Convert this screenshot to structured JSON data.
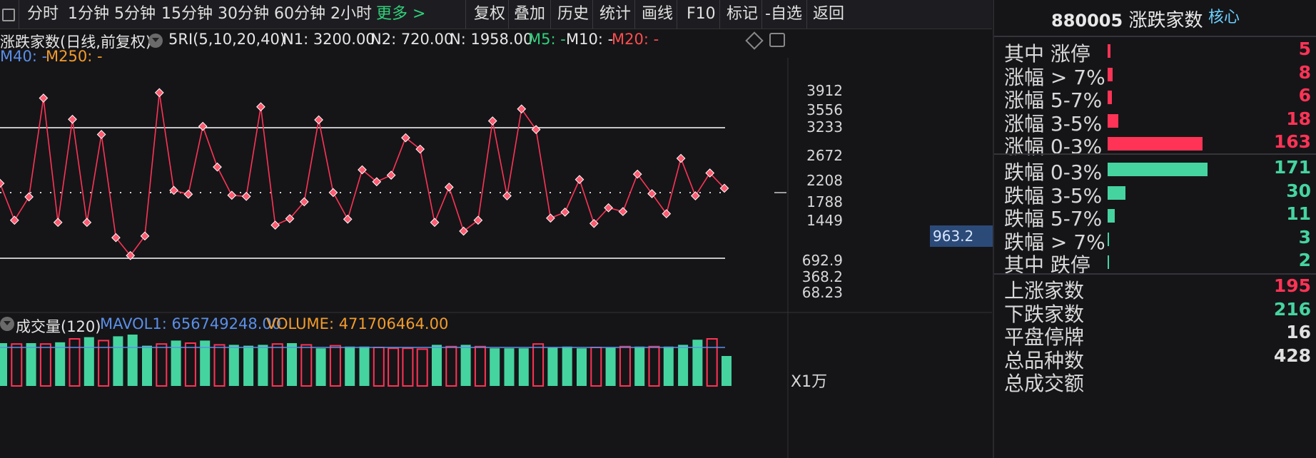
{
  "toolbar": {
    "items": [
      "分时",
      "1分钟",
      "5分钟",
      "15分钟",
      "30分钟",
      "60分钟",
      "2小时"
    ],
    "more": "更多 >",
    "right_items": [
      "复权",
      "叠加",
      "历史",
      "统计",
      "画线",
      "F10",
      "标记",
      "-自选",
      "返回"
    ]
  },
  "chart_header": {
    "title": "涨跌家数(日线,前复权)",
    "indicator": "5RI(5,10,20,40)",
    "n1": "N1: 3200.00",
    "n2": "N2: 720.00",
    "n": "N: 1958.00",
    "m5": "M5: -",
    "m10": "M10: -",
    "m20": "M20: -",
    "m40": "M40: -",
    "m250": "M250: -"
  },
  "price_tag": "963.2",
  "volume_header": {
    "title": "成交量(120)",
    "mavol": "MAVOL1: 656749248.00",
    "volume": "VOLUME: 471706464.00"
  },
  "volume_unit": "X1万",
  "colors": {
    "up": "#ff3355",
    "down": "#45d4a0",
    "line": "#ff3355",
    "grid_line": "#ffffff",
    "dotted": "#cccccc",
    "mavol": "#5b8fe8"
  },
  "right_panel": {
    "code": "880005",
    "name": "涨跌家数",
    "core": "核心",
    "up_rows": [
      {
        "label": "其中 涨停",
        "value": "5",
        "ratio": 0.03
      },
      {
        "label": "涨幅 > 7%",
        "value": "8",
        "ratio": 0.05
      },
      {
        "label": "涨幅 5-7%",
        "value": "6",
        "ratio": 0.04
      },
      {
        "label": "涨幅 3-5%",
        "value": "18",
        "ratio": 0.11
      },
      {
        "label": "涨幅 0-3%",
        "value": "163",
        "ratio": 0.95
      }
    ],
    "down_rows": [
      {
        "label": "跌幅 0-3%",
        "value": "171",
        "ratio": 1.0
      },
      {
        "label": "跌幅 3-5%",
        "value": "30",
        "ratio": 0.18
      },
      {
        "label": "跌幅 5-7%",
        "value": "11",
        "ratio": 0.07
      },
      {
        "label": "跌幅 > 7%",
        "value": "3",
        "ratio": 0.015
      },
      {
        "label": "其中 跌停",
        "value": "2",
        "ratio": 0.01
      }
    ],
    "summary": [
      {
        "label": "上涨家数",
        "value": "195",
        "color": "#ff3355"
      },
      {
        "label": "下跌家数",
        "value": "216",
        "color": "#45d4a0"
      },
      {
        "label": "平盘停牌",
        "value": "16",
        "color": "#e0e0e0"
      },
      {
        "label": "总品种数",
        "value": "428",
        "color": "#e0e0e0"
      },
      {
        "label": "总成交额",
        "value": "",
        "color": "#e0e0e0"
      }
    ]
  },
  "chart_data": {
    "type": "line",
    "title": "涨跌家数(日线,前复权)",
    "y_ticks": [
      "3912",
      "3556",
      "3233",
      "2672",
      "2208",
      "1788",
      "1449",
      "692.9",
      "368.2",
      "68.23"
    ],
    "reference_lines": {
      "n1": 3200,
      "n2": 720,
      "n": 1958
    },
    "series": [
      {
        "values": [
          2050,
          1370,
          1800,
          3620,
          1330,
          3230,
          1330,
          2950,
          1050,
          720,
          1080,
          3720,
          1920,
          1850,
          3100,
          2350,
          1830,
          1810,
          3460,
          1280,
          1400,
          1710,
          3220,
          1880,
          1390,
          2300,
          2080,
          2200,
          2890,
          2680,
          1330,
          1980,
          1170,
          1370,
          3200,
          1820,
          3420,
          3040,
          1410,
          1520,
          2120,
          1310,
          1600,
          1530,
          2220,
          1860,
          1490,
          2510,
          1820,
          2240,
          1960
        ]
      }
    ],
    "volume": [
      {
        "v": 50,
        "up": true
      },
      {
        "v": 49,
        "up": false
      },
      {
        "v": 50,
        "up": true
      },
      {
        "v": 49,
        "up": false
      },
      {
        "v": 51,
        "up": true
      },
      {
        "v": 55,
        "up": false
      },
      {
        "v": 57,
        "up": true
      },
      {
        "v": 53,
        "up": false
      },
      {
        "v": 58,
        "up": true
      },
      {
        "v": 60,
        "up": true
      },
      {
        "v": 47,
        "up": true
      },
      {
        "v": 49,
        "up": false
      },
      {
        "v": 53,
        "up": true
      },
      {
        "v": 50,
        "up": false
      },
      {
        "v": 53,
        "up": true
      },
      {
        "v": 48,
        "up": false
      },
      {
        "v": 48,
        "up": true
      },
      {
        "v": 47,
        "up": true
      },
      {
        "v": 48,
        "up": true
      },
      {
        "v": 49,
        "up": false
      },
      {
        "v": 50,
        "up": true
      },
      {
        "v": 48,
        "up": false
      },
      {
        "v": 44,
        "up": true
      },
      {
        "v": 47,
        "up": false
      },
      {
        "v": 46,
        "up": true
      },
      {
        "v": 46,
        "up": true
      },
      {
        "v": 45,
        "up": false
      },
      {
        "v": 44,
        "up": false
      },
      {
        "v": 44,
        "up": false
      },
      {
        "v": 43,
        "up": false
      },
      {
        "v": 48,
        "up": true
      },
      {
        "v": 46,
        "up": false
      },
      {
        "v": 48,
        "up": true
      },
      {
        "v": 46,
        "up": false
      },
      {
        "v": 44,
        "up": true
      },
      {
        "v": 44,
        "up": true
      },
      {
        "v": 44,
        "up": true
      },
      {
        "v": 49,
        "up": false
      },
      {
        "v": 45,
        "up": true
      },
      {
        "v": 46,
        "up": true
      },
      {
        "v": 44,
        "up": true
      },
      {
        "v": 45,
        "up": false
      },
      {
        "v": 45,
        "up": true
      },
      {
        "v": 46,
        "up": false
      },
      {
        "v": 46,
        "up": true
      },
      {
        "v": 46,
        "up": false
      },
      {
        "v": 46,
        "up": true
      },
      {
        "v": 48,
        "up": true
      },
      {
        "v": 54,
        "up": true
      },
      {
        "v": 55,
        "up": false
      },
      {
        "v": 35,
        "up": true
      }
    ]
  }
}
